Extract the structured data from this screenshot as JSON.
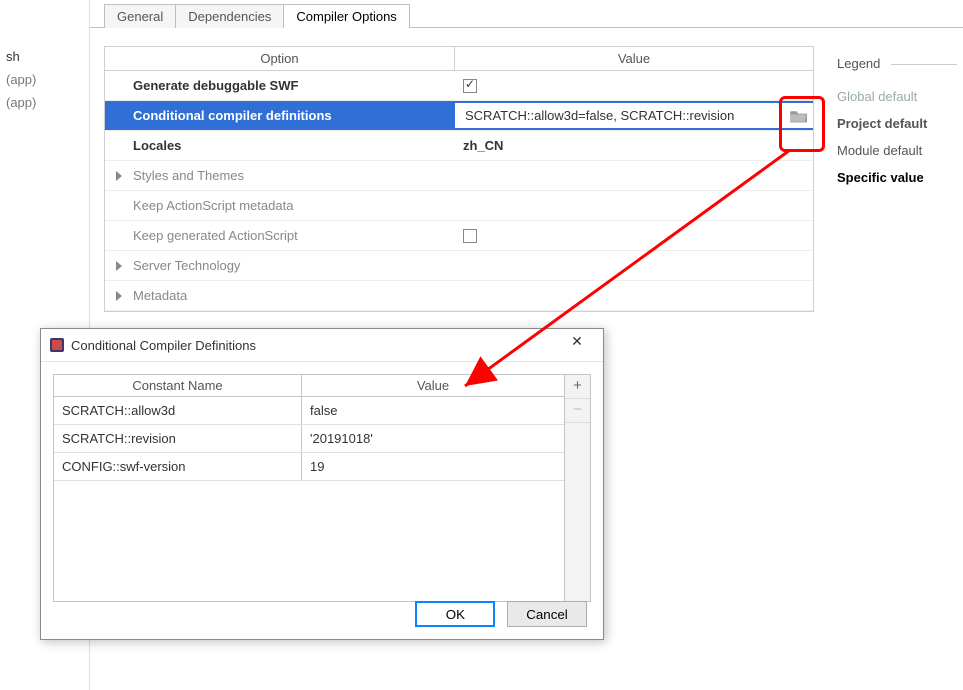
{
  "left_panel": {
    "item1": "sh",
    "item2": "(app)",
    "item3": "(app)"
  },
  "tabs": {
    "general": "General",
    "dependencies": "Dependencies",
    "compiler_options": "Compiler Options"
  },
  "headers": {
    "option": "Option",
    "value": "Value"
  },
  "options": {
    "generate_swf": "Generate debuggable SWF",
    "cond_def": "Conditional compiler definitions",
    "cond_def_value": "SCRATCH::allow3d=false, SCRATCH::revision",
    "locales": "Locales",
    "locales_value": "zh_CN",
    "styles": "Styles and Themes",
    "keep_meta": "Keep ActionScript metadata",
    "keep_gen": "Keep generated ActionScript",
    "server_tech": "Server Technology",
    "metadata": "Metadata"
  },
  "legend": {
    "title": "Legend",
    "global": "Global default",
    "project": "Project default",
    "module": "Module default",
    "specific": "Specific value"
  },
  "dialog": {
    "title": "Conditional Compiler Definitions",
    "col1": "Constant Name",
    "col2": "Value",
    "rows": [
      {
        "name": "SCRATCH::allow3d",
        "value": "false"
      },
      {
        "name": "SCRATCH::revision",
        "value": "'20191018'"
      },
      {
        "name": "CONFIG::swf-version",
        "value": "19"
      }
    ],
    "ok": "OK",
    "cancel": "Cancel"
  }
}
